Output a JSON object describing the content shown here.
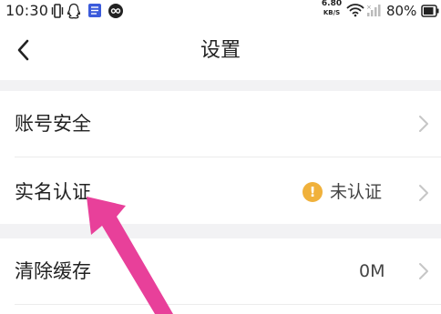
{
  "status_bar": {
    "time": "10:30",
    "net_speed_value": "6.80",
    "net_speed_unit": "KB/S",
    "battery": "80%",
    "icons": [
      "vibrate-icon",
      "qq-icon",
      "notes-icon",
      "infinity-app-icon",
      "wifi-icon",
      "signal-icon",
      "battery-icon"
    ]
  },
  "nav": {
    "title": "设置",
    "back_icon": "chevron-left-icon"
  },
  "settings": {
    "account_security": {
      "label": "账号安全"
    },
    "real_name": {
      "label": "实名认证",
      "status": "未认证",
      "status_icon": "!"
    },
    "clear_cache": {
      "label": "清除缓存",
      "value": "0M"
    }
  },
  "colors": {
    "warning": "#f0b13b",
    "annotation_arrow": "#e8409a",
    "section_gap": "#f2f2f4"
  }
}
